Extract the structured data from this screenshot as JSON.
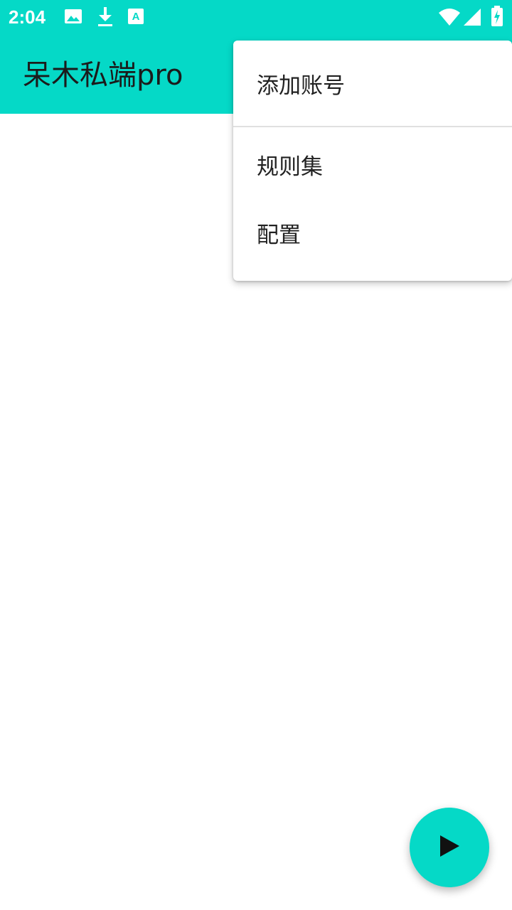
{
  "status_bar": {
    "time": "2:04",
    "icons": [
      "image-icon",
      "download-icon",
      "a-badge-icon",
      "wifi-icon",
      "signal-icon",
      "battery-charging-icon"
    ]
  },
  "app_bar": {
    "title": "呆木私端pro"
  },
  "overflow_menu": {
    "items": [
      {
        "label": "添加账号"
      },
      {
        "label": "规则集"
      },
      {
        "label": "配置"
      }
    ]
  },
  "fab": {
    "icon": "play-icon"
  },
  "colors": {
    "accent": "#05d9c7",
    "background": "#ffffff",
    "text": "#222222"
  }
}
